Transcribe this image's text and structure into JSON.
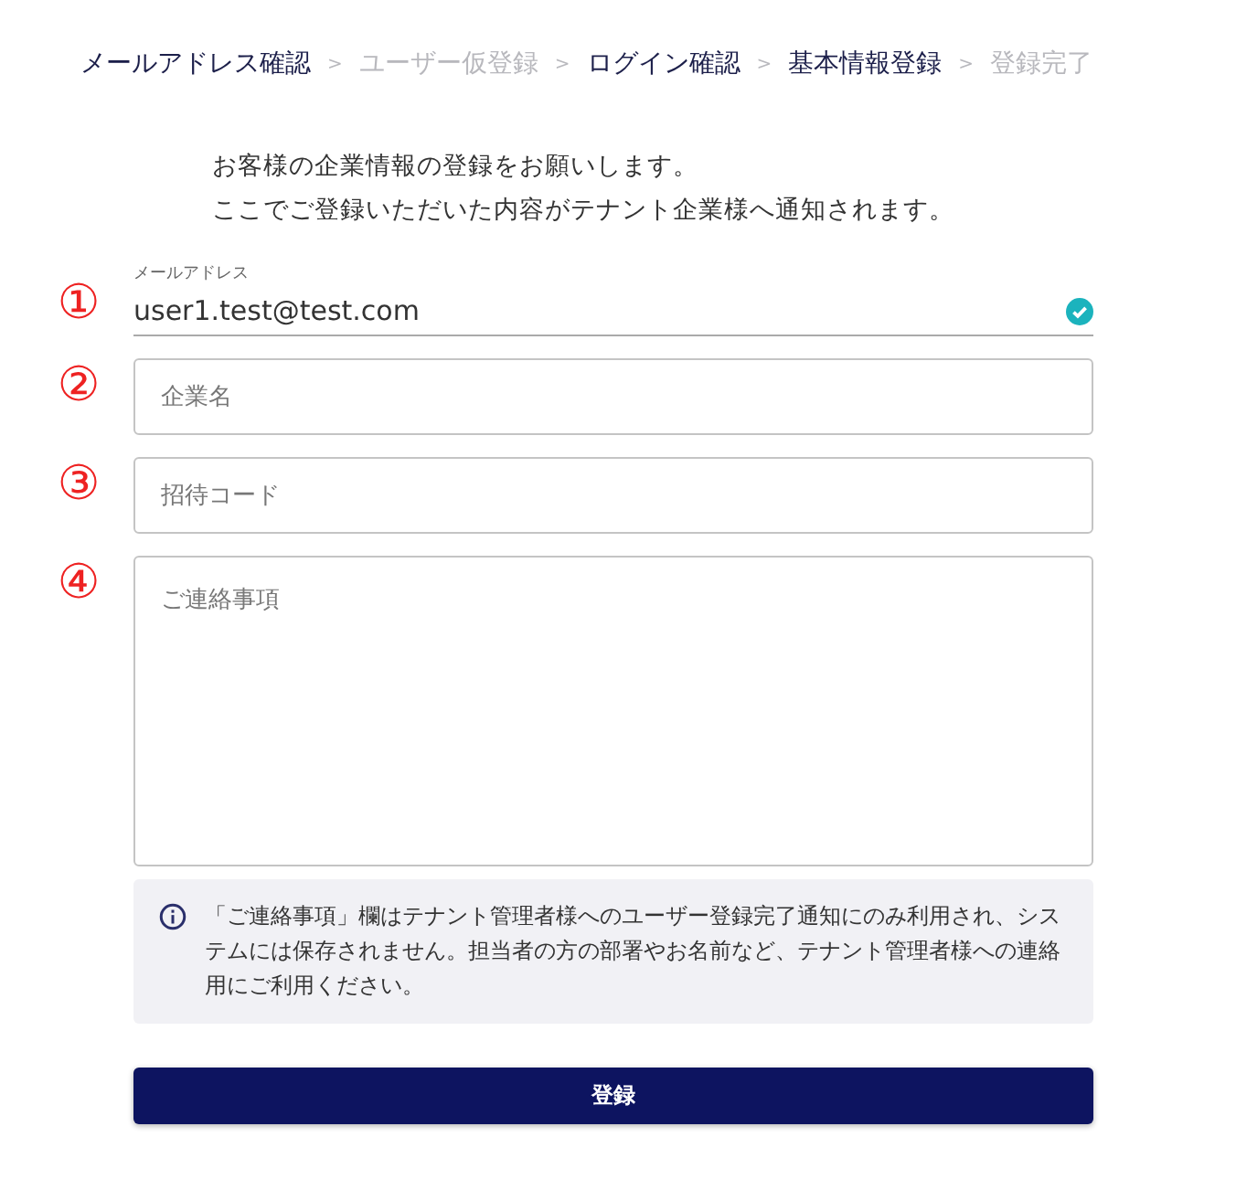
{
  "steps": [
    {
      "label": "メールアドレス確認",
      "enabled": true
    },
    {
      "label": "ユーザー仮登録",
      "enabled": false
    },
    {
      "label": "ログイン確認",
      "enabled": true
    },
    {
      "label": "基本情報登録",
      "enabled": true
    },
    {
      "label": "登録完了",
      "enabled": false
    }
  ],
  "step_separator": ">",
  "intro": [
    "お客様の企業情報の登録をお願いします。",
    "ここでご登録いただいた内容がテナント企業様へ通知されます。"
  ],
  "fields": [
    {
      "marker": "①",
      "kind": "underline",
      "label": "メールアドレス",
      "value": "user1.test@test.com",
      "valid": true
    },
    {
      "marker": "②",
      "kind": "outlined",
      "placeholder": "企業名"
    },
    {
      "marker": "③",
      "kind": "outlined",
      "placeholder": "招待コード"
    },
    {
      "marker": "④",
      "kind": "textarea",
      "placeholder": "ご連絡事項"
    }
  ],
  "notice": "「ご連絡事項」欄はテナント管理者様へのユーザー登録完了通知にのみ利用され、システムには保存されません。担当者の方の部署やお名前など、テナント管理者様への連絡用にご利用ください。",
  "submit": {
    "label": "登録"
  }
}
